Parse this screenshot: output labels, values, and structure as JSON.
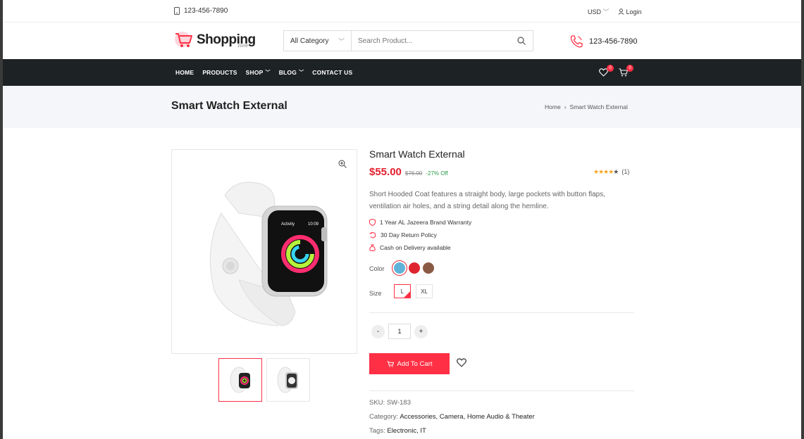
{
  "topbar": {
    "phone": "123-456-7890",
    "currency": "USD",
    "login": "Login"
  },
  "header": {
    "logo_text": "Shopping",
    "logo_sub": "zone",
    "category": "All Category",
    "search_placeholder": "Search Product...",
    "phone": "123-456-7890"
  },
  "nav": {
    "items": [
      "HOME",
      "PRODUCTS",
      "SHOP",
      "BLOG",
      "CONTACT US"
    ],
    "wishlist_count": "0",
    "cart_count": "0"
  },
  "band": {
    "title": "Smart Watch External",
    "crumb_home": "Home",
    "crumb_current": "Smart Watch External"
  },
  "product": {
    "title": "Smart Watch External",
    "price": "$55.00",
    "old_price": "$76.00",
    "discount": "-27% Off",
    "rating": 4,
    "stars": "★★★★★",
    "review_count": "(1)",
    "description": "Short Hooded Coat features a straight body, large pockets with button flaps, ventilation air holes, and a string detail along the hemline.",
    "features": [
      "1 Year AL Jazeera Brand Warranty",
      "30 Day Return Policy",
      "Cash on Delivery available"
    ],
    "color_label": "Color",
    "colors": [
      "#5fb3d9",
      "#e0242f",
      "#8a5a45"
    ],
    "size_label": "Size",
    "sizes": [
      "L",
      "XL"
    ],
    "quantity": "1",
    "qty_minus": "-",
    "qty_plus": "+",
    "add_to_cart": "Add To Cart",
    "sku_label": "SKU:",
    "sku": "SW-183",
    "category_label": "Category:",
    "categories": "Accessories, Camera, Home Audio & Theater",
    "tags_label": "Tags:",
    "tags": "Electronic, IT",
    "watch_screen_title": "Activity",
    "watch_screen_time": "10:09"
  }
}
